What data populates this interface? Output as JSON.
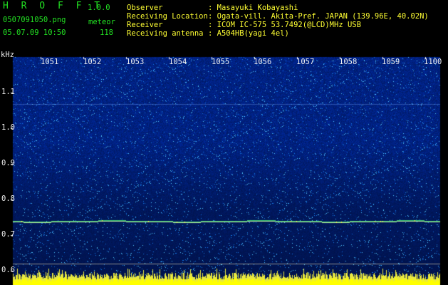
{
  "app": {
    "name": "H R O F F T",
    "version": "1.0.0"
  },
  "file": {
    "filename": "0507091050.png",
    "datetime": "05.07.09 10:50"
  },
  "meteor": {
    "label": "meteor",
    "count": "118"
  },
  "info": [
    {
      "key": "Observer",
      "value": ": Masayuki Kobayashi"
    },
    {
      "key": "Receiving Location",
      "value": ": Ogata-vill. Akita-Pref. JAPAN (139.96E, 40.02N)"
    },
    {
      "key": "Receiver",
      "value": ": ICOM IC-575 53.7492(@LCD)MHz USB"
    },
    {
      "key": "Receiving antenna",
      "value": ": A504HB(yagi 4el)"
    }
  ],
  "axis": {
    "unit": "kHz",
    "freq_ticks": [
      "1.1",
      "1.0",
      "0.9",
      "0.8",
      "0.7",
      "0.6"
    ],
    "time_ticks": [
      "1051",
      "1052",
      "1053",
      "1054",
      "1055",
      "1056",
      "1057",
      "1058",
      "1059",
      "1100"
    ]
  },
  "colors": {
    "background": "#000000",
    "spectrogram": "#0a1d7a",
    "text_green": "#22e022",
    "text_yellow": "#ffff33",
    "grid": "#ffffff",
    "carrier": "#40e0a0",
    "histogram": "#ffff00"
  }
}
